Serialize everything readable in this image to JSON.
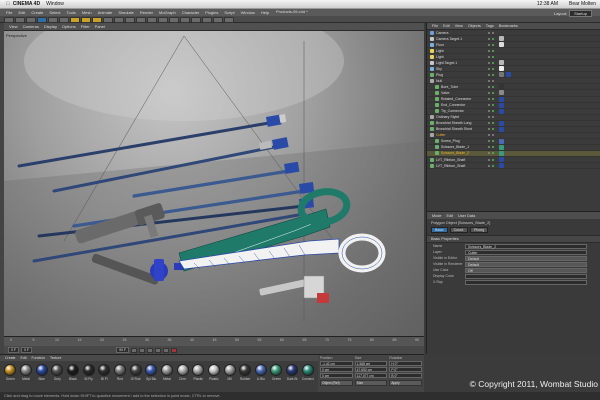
{
  "mac_menubar": {
    "apple": "",
    "app_name": "CINEMA 4D",
    "items": [
      "Window"
    ],
    "right": [
      "12:38 AM",
      "Bear Molten"
    ]
  },
  "c4d": {
    "doc_title": "Products-05.c4d *",
    "menus": [
      "File",
      "Edit",
      "Create",
      "Select",
      "Tools",
      "Mesh",
      "Animate",
      "Simulate",
      "Render",
      "MoGraph",
      "Character",
      "Plugins",
      "Script",
      "Window",
      "Help"
    ],
    "layout_label": "Layout:",
    "layout_value": "Startup"
  },
  "viewport": {
    "menus": [
      "View",
      "Cameras",
      "Display",
      "Options",
      "Filter",
      "Panel"
    ],
    "label": "Perspective"
  },
  "timeline": {
    "ticks": [
      "0",
      "5",
      "10",
      "15",
      "20",
      "25",
      "30",
      "35",
      "40",
      "45",
      "50",
      "55",
      "60",
      "65",
      "70",
      "75",
      "80",
      "85",
      "90"
    ],
    "start_field": "0 F",
    "current_field": "0 F",
    "end_field": "90 F"
  },
  "materials": {
    "tabs": [
      "Create",
      "Edit",
      "Function",
      "Texture"
    ],
    "items": [
      {
        "name": "Green",
        "color": "#c89020"
      },
      {
        "name": "Metal",
        "color": "#8a8a8a"
      },
      {
        "name": "Blue",
        "color": "#2a4aa8"
      },
      {
        "name": "Grey",
        "color": "#555555"
      },
      {
        "name": "Black",
        "color": "#1c1c1c"
      },
      {
        "name": "Bl Ply",
        "color": "#2a2a2a"
      },
      {
        "name": "Bl Pl",
        "color": "#303030"
      },
      {
        "name": "Red",
        "color": "#7a7a7a"
      },
      {
        "name": "Gl Rub",
        "color": "#444444"
      },
      {
        "name": "Spl Blu",
        "color": "#3a5ab0"
      },
      {
        "name": "Metal",
        "color": "#9a9a9a"
      },
      {
        "name": "Chm",
        "color": "#b0b0b0"
      },
      {
        "name": "Plastic",
        "color": "#aaaaaa"
      },
      {
        "name": "Plastic",
        "color": "#c8c8c8"
      },
      {
        "name": "Mtl",
        "color": "#a0a0a0"
      },
      {
        "name": "Rubber",
        "color": "#3a3a3a"
      },
      {
        "name": "Lt Blu",
        "color": "#4a6ab8"
      },
      {
        "name": "Green",
        "color": "#3a9a7a"
      },
      {
        "name": "Dark Bl",
        "color": "#2a3a7a"
      },
      {
        "name": "Connect",
        "color": "#2a8a7a"
      }
    ]
  },
  "coordinates": {
    "headers": [
      "Position",
      "Size",
      "Rotation"
    ],
    "rows": [
      [
        "-1.42 cm",
        "1.568 cm",
        "H 0°"
      ],
      [
        "0 cm",
        "47.692 cm",
        "P 0°"
      ],
      [
        "0 cm",
        "117.077 cm",
        "B 0°"
      ]
    ],
    "object_mode": "Object (Rel)",
    "size_mode": "Size",
    "apply_label": "Apply"
  },
  "status_text": "Click and drag to move elements. Hold down SHIFT to quantize movement / add to the selection in point mode, CTRL to remove.",
  "objects": {
    "menus": [
      "File",
      "Edit",
      "View",
      "Objects",
      "Tags",
      "Bookmarks"
    ],
    "rows": [
      {
        "name": "Camera",
        "icon": "#6aa0d8",
        "tags": []
      },
      {
        "name": "Camera.Target.1",
        "icon": "#c8c8c8",
        "tags": [
          "#b8b8b8"
        ]
      },
      {
        "name": "Floor",
        "icon": "#7ab0e0",
        "tags": [
          "#dddddd"
        ]
      },
      {
        "name": "Light",
        "icon": "#e8d060",
        "tags": []
      },
      {
        "name": "Light",
        "icon": "#e8d060",
        "tags": []
      },
      {
        "name": "Light.Target.1",
        "icon": "#c8c8c8",
        "tags": [
          "#b8b8b8"
        ]
      },
      {
        "name": "Sky",
        "icon": "#7ab0e0",
        "tags": [
          "#eeeeee"
        ]
      },
      {
        "name": "Plug",
        "icon": "#6ab06a",
        "tags": [
          "#777777",
          "#2a4aa8"
        ]
      },
      {
        "name": "Null",
        "icon": "#a8a8a8",
        "tags": []
      },
      {
        "name": "Bore_Tube",
        "icon": "#6ab06a",
        "tags": [
          "#333333"
        ]
      },
      {
        "name": "Valve",
        "icon": "#6ab06a",
        "tags": [
          "#8a8a8a"
        ]
      },
      {
        "name": "Rotated_Connector",
        "icon": "#6ab06a",
        "tags": [
          "#2a4aa8"
        ]
      },
      {
        "name": "End_Connector",
        "icon": "#6ab06a",
        "tags": [
          "#2a4aa8"
        ]
      },
      {
        "name": "Tip_Connector",
        "icon": "#6ab06a",
        "tags": [
          "#2a4aa8"
        ]
      },
      {
        "name": "Ordinary Stylet",
        "icon": "#a8a8a8",
        "tags": []
      },
      {
        "name": "Bronchial Sheath Long",
        "icon": "#6ab06a",
        "tags": [
          "#2a4aa8"
        ]
      },
      {
        "name": "Bronchial Sheath Short",
        "icon": "#6ab06a",
        "tags": [
          "#2a4aa8"
        ]
      },
      {
        "name": "Cutter",
        "icon": "#a8a8a8",
        "tags": [],
        "highlight": true
      },
      {
        "name": "Screw_Plug",
        "icon": "#6ab06a",
        "tags": [
          "#4a6ab8"
        ]
      },
      {
        "name": "Scissors_Blade_1",
        "icon": "#6ab06a",
        "tags": [
          "#3a9a7a"
        ]
      },
      {
        "name": "Scissors_Blade_2",
        "icon": "#6ab06a",
        "tags": [
          "#3a9a7a"
        ],
        "selected": true,
        "highlight": true
      },
      {
        "name": "LVT_Ribbon_Shaft",
        "icon": "#6ab06a",
        "tags": [
          "#2a4aa8"
        ]
      },
      {
        "name": "LVT_Ribbon_Shaft",
        "icon": "#6ab06a",
        "tags": [
          "#2a4aa8"
        ]
      }
    ]
  },
  "attributes": {
    "menus": [
      "Mode",
      "Edit",
      "User Data"
    ],
    "title": "Polygon Object [Scissors_Blade_2]",
    "tabs": [
      "Basic",
      "Coord.",
      "Phong"
    ],
    "section": "Basic Properties",
    "rows": [
      {
        "label": "Name",
        "value": "Scissors_Blade_2",
        "dropdown": false
      },
      {
        "label": "Layer",
        "value": "Cutter",
        "dropdown": false
      },
      {
        "label": "Visible in Editor",
        "value": "Default",
        "dropdown": true
      },
      {
        "label": "Visible in Renderer",
        "value": "Default",
        "dropdown": true
      },
      {
        "label": "Use Color",
        "value": "Off",
        "dropdown": true
      },
      {
        "label": "Display Color",
        "value": "",
        "dropdown": false
      },
      {
        "label": "X-Ray",
        "value": "",
        "dropdown": false
      }
    ]
  },
  "copyright": "© Copyright 2011, Wombat Studio",
  "colors": {
    "selection_blue": "#2f6fa8",
    "highlight_orange": "#f0b030",
    "scissor_teal": "#1f7a6a"
  }
}
